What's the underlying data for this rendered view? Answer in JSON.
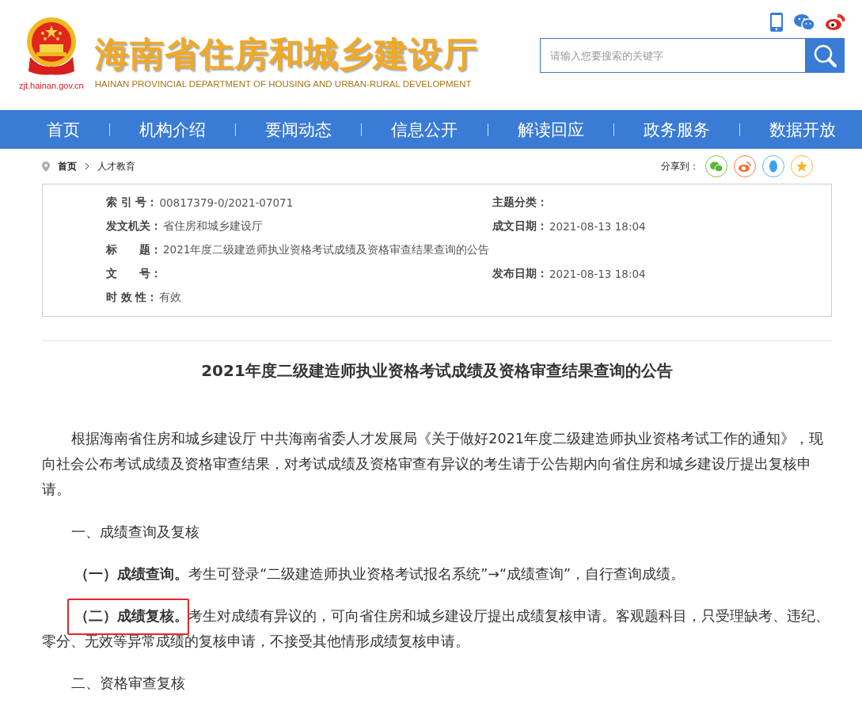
{
  "header": {
    "site_url": "zjt.hainan.gov.cn",
    "title": "海南省住房和城乡建设厅",
    "subtitle": "HAINAN PROVINCIAL DEPARTMENT OF HOUSING AND URBAN-RURAL DEVELOPMENT",
    "search": {
      "placeholder": "请输入您要搜索的关键字"
    }
  },
  "nav": [
    {
      "label": "首页"
    },
    {
      "label": "机构介绍"
    },
    {
      "label": "要闻动态"
    },
    {
      "label": "信息公开"
    },
    {
      "label": "解读回应"
    },
    {
      "label": "政务服务"
    },
    {
      "label": "数据开放"
    }
  ],
  "breadcrumb": [
    "首页",
    "人才教育"
  ],
  "share_label": "分享到：",
  "meta": [
    {
      "left": {
        "label": "索 引 号：",
        "value": "00817379-0/2021-07071"
      },
      "right": {
        "label": "主题分类："
      }
    },
    {
      "left": {
        "label": "发文机关：",
        "value": "省住房和城乡建设厅"
      },
      "right": {
        "label": "成文日期：",
        "value": "2021-08-13 18:04"
      }
    },
    {
      "left": {
        "label": "标　　题：",
        "value": "2021年度二级建造师执业资格考试成绩及资格审查结果查询的公告"
      }
    },
    {
      "left": {
        "label": "文　　号："
      },
      "right": {
        "label": "发布日期：",
        "value": "2021-08-13 18:04"
      }
    },
    {
      "left": {
        "label": "时 效 性：",
        "value": "有效"
      }
    }
  ],
  "article": {
    "title": "2021年度二级建造师执业资格考试成绩及资格审查结果查询的公告",
    "paragraphs": [
      {
        "kind": "body",
        "text": "根据海南省住房和城乡建设厅 中共海南省委人才发展局《关于做好2021年度二级建造师执业资格考试工作的通知》，现向社会公布考试成绩及资格审查结果，对考试成绩及资格审查有异议的考生请于公告期内向省住房和城乡建设厅提出复核申请。",
        "highlighted": false
      },
      {
        "kind": "heading",
        "text": "一、成绩查询及复核",
        "highlighted": false
      },
      {
        "kind": "item",
        "text": "**（一）成绩查询。**考生可登录“二级建造师执业资格考试报名系统”→“成绩查询”，自行查询成绩。",
        "highlighted": false
      },
      {
        "kind": "item",
        "text": "**（二）成绩复核。**考生对成绩有异议的，可向省住房和城乡建设厅提出成绩复核申请。客观题科目，只受理缺考、违纪、零分、无效等异常成绩的复核申请，不接受其他情形成绩复核申请。",
        "highlighted": true
      },
      {
        "kind": "heading",
        "text": "二、资格审查复核",
        "highlighted": false
      }
    ]
  }
}
